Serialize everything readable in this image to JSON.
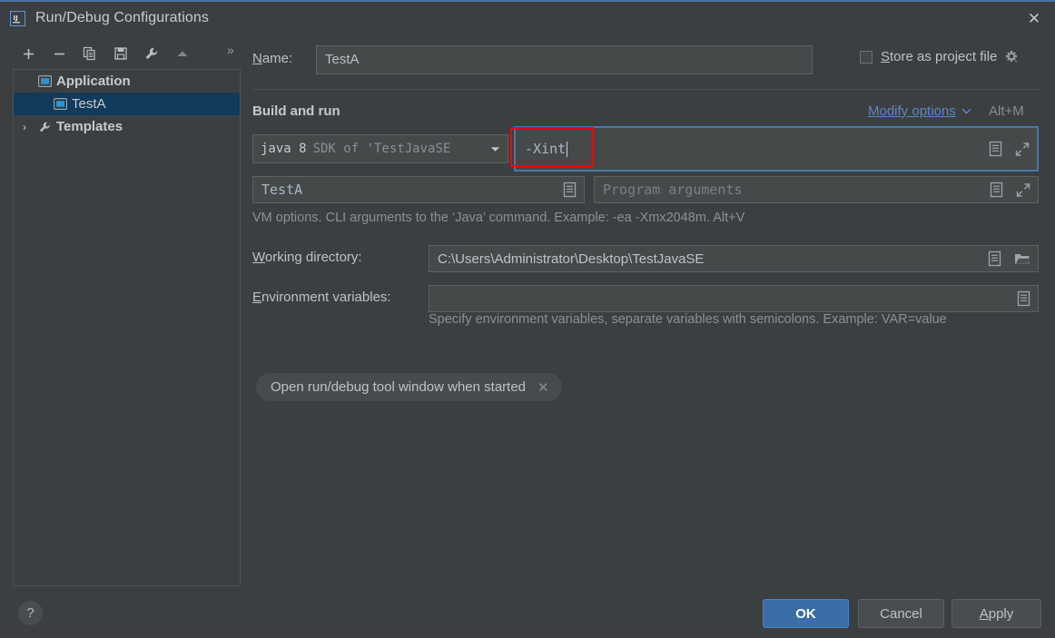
{
  "window": {
    "title": "Run/Debug Configurations",
    "app_icon": "intellij-idea-icon",
    "close_label": "✕"
  },
  "toolbar": {
    "buttons": [
      {
        "name": "add",
        "icon": "plus-icon",
        "label": "+"
      },
      {
        "name": "remove",
        "icon": "minus-icon",
        "label": "−"
      },
      {
        "name": "copy",
        "icon": "copy-icon",
        "label": "Copy"
      },
      {
        "name": "save",
        "icon": "save-icon",
        "label": "Save"
      },
      {
        "name": "edit-templates",
        "icon": "wrench-icon",
        "label": "Edit Templates"
      },
      {
        "name": "move-up",
        "icon": "arrow-up-icon",
        "label": "Move Up"
      }
    ],
    "more_label": "»"
  },
  "tree": {
    "items": [
      {
        "label": "Application",
        "icon": "application-icon",
        "twisty": "ⱟ",
        "level": 1,
        "bold": true,
        "selected": false
      },
      {
        "label": "TestA",
        "icon": "application-icon",
        "twisty": "",
        "level": 2,
        "bold": false,
        "selected": true
      },
      {
        "label": "Templates",
        "icon": "wrench-icon",
        "twisty": "›",
        "level": 1,
        "bold": true,
        "selected": false
      }
    ]
  },
  "form": {
    "name_label": "Name:",
    "name_label_mnemonic": "N",
    "name_value": "TestA",
    "store_as_project_file_label": "Store as project file",
    "store_as_project_file_mnemonic": "S",
    "store_as_project_file_checked": false,
    "store_gear_icon": "gear-dropdown-icon",
    "section_title": "Build and run",
    "modify_options_label": "Modify options",
    "modify_options_mnemonic": "M",
    "modify_options_chevron": "⌄",
    "modify_options_shortcut": "Alt+M",
    "jdk_main": "java 8",
    "jdk_sub": "SDK of 'TestJavaSE",
    "jdk_caret": "▾",
    "vm_options_value": "-Xint",
    "vm_options_focused": true,
    "main_class_value": "TestA",
    "program_arguments_placeholder": "Program arguments",
    "vm_hint": "VM options. CLI arguments to the ‘Java’ command. Example: -ea -Xmx2048m. Alt+V",
    "working_directory_label": "Working directory:",
    "working_directory_mnemonic": "W",
    "working_directory_value": "C:\\Users\\Administrator\\Desktop\\TestJavaSE",
    "environment_variables_label": "Environment variables:",
    "environment_variables_mnemonic": "E",
    "environment_variables_value": "",
    "environment_hint": "Specify environment variables, separate variables with semicolons. Example: VAR=value",
    "chip_label": "Open run/debug tool window when started",
    "chip_close": "✕"
  },
  "footer": {
    "help_label": "?",
    "ok_label": "OK",
    "cancel_label": "Cancel",
    "apply_label": "Apply",
    "apply_mnemonic": "A"
  },
  "colors": {
    "background": "#3c3f41",
    "field_background": "#45494a",
    "accent_blue": "#3b6ea8",
    "link_blue": "#5b87c7",
    "selection_blue": "#113a5c",
    "focus_border": "#4a76ad",
    "highlight_red": "#ff0000",
    "code_text": "#a9b7c6"
  }
}
